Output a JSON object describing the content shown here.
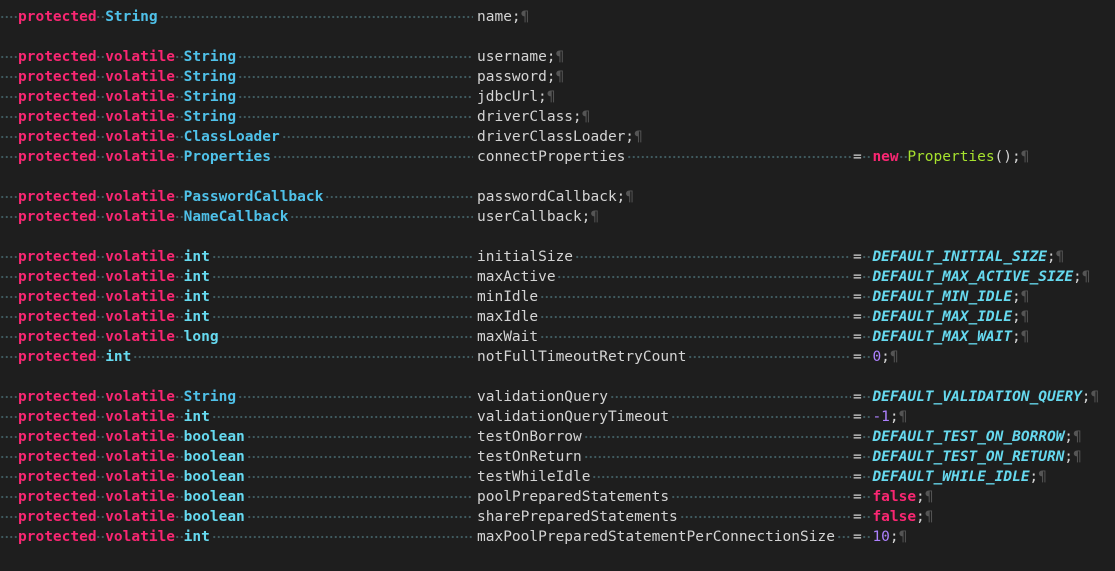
{
  "editor": {
    "pilcrow": "¶",
    "lines": [
      {
        "mods": "protected",
        "type": "String",
        "name": "name",
        "tail": ";"
      },
      {
        "blank": true
      },
      {
        "mods": "protected volatile",
        "type": "String",
        "name": "username",
        "tail": ";"
      },
      {
        "mods": "protected volatile",
        "type": "String",
        "name": "password",
        "tail": ";"
      },
      {
        "mods": "protected volatile",
        "type": "String",
        "name": "jdbcUrl",
        "tail": ";"
      },
      {
        "mods": "protected volatile",
        "type": "String",
        "name": "driverClass",
        "tail": ";"
      },
      {
        "mods": "protected volatile",
        "type": "ClassLoader",
        "name": "driverClassLoader",
        "tail": ";"
      },
      {
        "mods": "protected volatile",
        "type": "Properties",
        "name": "connectProperties",
        "init": {
          "kind": "new",
          "newkw": "new",
          "ctor": "Properties",
          "rest": "();"
        }
      },
      {
        "blank": true
      },
      {
        "mods": "protected volatile",
        "type": "PasswordCallback",
        "name": "passwordCallback",
        "tail": ";"
      },
      {
        "mods": "protected volatile",
        "type": "NameCallback",
        "name": "userCallback",
        "tail": ";"
      },
      {
        "blank": true
      },
      {
        "mods": "protected volatile",
        "type": "int",
        "name": "initialSize",
        "init": {
          "kind": "const",
          "value": "DEFAULT_INITIAL_SIZE"
        }
      },
      {
        "mods": "protected volatile",
        "type": "int",
        "name": "maxActive",
        "init": {
          "kind": "const",
          "value": "DEFAULT_MAX_ACTIVE_SIZE"
        }
      },
      {
        "mods": "protected volatile",
        "type": "int",
        "name": "minIdle",
        "init": {
          "kind": "const",
          "value": "DEFAULT_MIN_IDLE"
        }
      },
      {
        "mods": "protected volatile",
        "type": "int",
        "name": "maxIdle",
        "init": {
          "kind": "const",
          "value": "DEFAULT_MAX_IDLE"
        }
      },
      {
        "mods": "protected volatile",
        "type": "long",
        "name": "maxWait",
        "init": {
          "kind": "const",
          "value": "DEFAULT_MAX_WAIT"
        }
      },
      {
        "mods": "protected",
        "type": "int",
        "name": "notFullTimeoutRetryCount",
        "init": {
          "kind": "num",
          "value": "0"
        }
      },
      {
        "blank": true
      },
      {
        "mods": "protected volatile",
        "type": "String",
        "name": "validationQuery",
        "init": {
          "kind": "const",
          "value": "DEFAULT_VALIDATION_QUERY"
        }
      },
      {
        "mods": "protected volatile",
        "type": "int",
        "name": "validationQueryTimeout",
        "init": {
          "kind": "num",
          "value": "-1"
        }
      },
      {
        "mods": "protected volatile",
        "type": "boolean",
        "name": "testOnBorrow",
        "init": {
          "kind": "const",
          "value": "DEFAULT_TEST_ON_BORROW"
        }
      },
      {
        "mods": "protected volatile",
        "type": "boolean",
        "name": "testOnReturn",
        "init": {
          "kind": "const",
          "value": "DEFAULT_TEST_ON_RETURN"
        }
      },
      {
        "mods": "protected volatile",
        "type": "boolean",
        "name": "testWhileIdle",
        "init": {
          "kind": "const",
          "value": "DEFAULT_WHILE_IDLE"
        }
      },
      {
        "mods": "protected volatile",
        "type": "boolean",
        "name": "poolPreparedStatements",
        "init": {
          "kind": "false",
          "value": "false"
        }
      },
      {
        "mods": "protected volatile",
        "type": "boolean",
        "name": "sharePreparedStatements",
        "init": {
          "kind": "false",
          "value": "false"
        }
      },
      {
        "mods": "protected volatile",
        "type": "int",
        "name": "maxPoolPreparedStatementPerConnectionSize",
        "init": {
          "kind": "num",
          "value": "10"
        }
      }
    ]
  },
  "colors": {
    "background": "#1e1e1e",
    "keyword": "#f92672",
    "type": "#66d9ef",
    "constant": "#66d9ef",
    "number": "#ae81ff",
    "constructor": "#a6e22e",
    "identifier": "#d4d4d4",
    "whitespace_marker": "#3f5a5f"
  }
}
